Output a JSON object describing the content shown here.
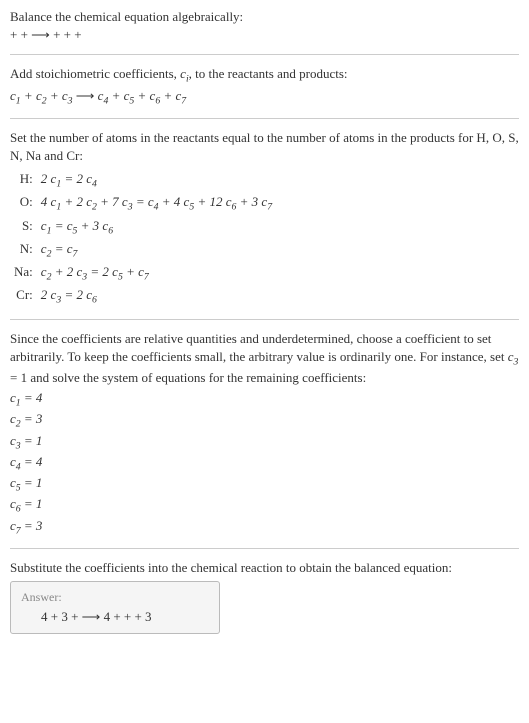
{
  "intro1": "Balance the chemical equation algebraically:",
  "intro2_pre": " +  + ",
  "intro2_arrow": " ⟶ ",
  "intro2_post": " +  +  + ",
  "stoich_text": "Add stoichiometric coefficients, ",
  "stoich_var": "c",
  "stoich_sub": "i",
  "stoich_text2": ", to the reactants and products:",
  "stoich_eq_left": [
    "c",
    "1",
    " + ",
    "c",
    "2",
    " + ",
    "c",
    "3",
    " "
  ],
  "stoich_eq_arrow": "⟶ ",
  "stoich_eq_right": [
    "c",
    "4",
    " + ",
    "c",
    "5",
    " + ",
    "c",
    "6",
    " + ",
    "c",
    "7"
  ],
  "atoms_text": "Set the number of atoms in the reactants equal to the number of atoms in the products for H, O, S, N, Na and Cr:",
  "rows": [
    {
      "label": "H:",
      "eq": "2 c₁ = 2 c₄"
    },
    {
      "label": "O:",
      "eq": "4 c₁ + 2 c₂ + 7 c₃ = c₄ + 4 c₅ + 12 c₆ + 3 c₇"
    },
    {
      "label": "S:",
      "eq": "c₁ = c₅ + 3 c₆"
    },
    {
      "label": "N:",
      "eq": "c₂ = c₇"
    },
    {
      "label": "Na:",
      "eq": "c₂ + 2 c₃ = 2 c₅ + c₇"
    },
    {
      "label": "Cr:",
      "eq": "2 c₃ = 2 c₆"
    }
  ],
  "underdet1": "Since the coefficients are relative quantities and underdetermined, choose a coefficient to set arbitrarily. To keep the coefficients small, the arbitrary value is ordinarily one. For instance, set ",
  "underdet_var": "c",
  "underdet_sub": "3",
  "underdet2": " = 1 and solve the system of equations for the remaining coefficients:",
  "coeffs": [
    "c₁ = 4",
    "c₂ = 3",
    "c₃ = 1",
    "c₄ = 4",
    "c₅ = 1",
    "c₆ = 1",
    "c₇ = 3"
  ],
  "subst_text": "Substitute the coefficients into the chemical reaction to obtain the balanced equation:",
  "answer_label": "Answer:",
  "answer_eq_left": "4  + 3  +  ",
  "answer_arrow": "⟶",
  "answer_eq_right": " 4  +  +  + 3 "
}
